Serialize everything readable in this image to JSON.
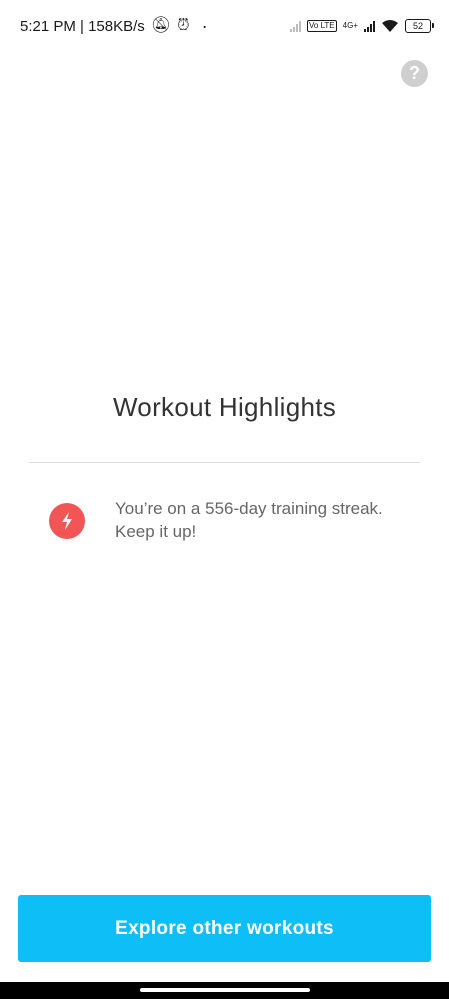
{
  "status_bar": {
    "time_speed": "5:21 PM | 158KB/s",
    "network_label": "4G+",
    "volte_label": "Vo LTE",
    "battery": "52"
  },
  "help": {
    "label": "?"
  },
  "main": {
    "title": "Workout Highlights",
    "highlight": {
      "icon": "lightning-bolt-icon",
      "text_line1": "You’re on a 556-day training streak.",
      "text_line2": "Keep it up!"
    }
  },
  "footer": {
    "button_label": "Explore other workouts"
  },
  "colors": {
    "accent": "#0ebff7",
    "streak_icon": "#f25555",
    "help_icon": "#cfcfcf"
  }
}
